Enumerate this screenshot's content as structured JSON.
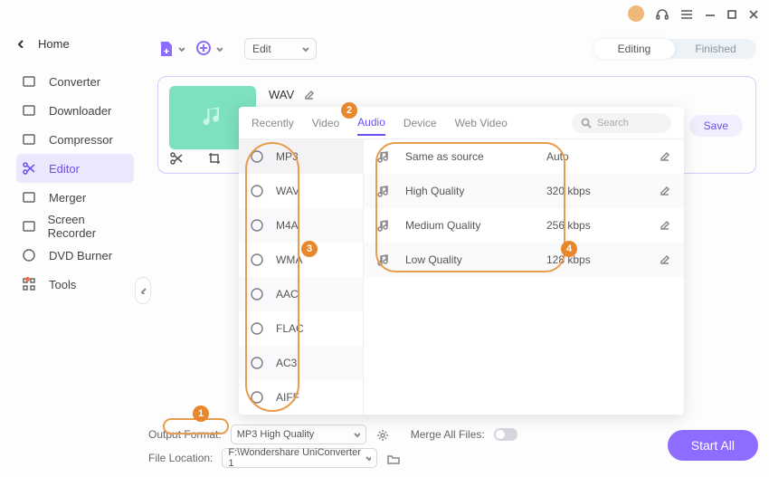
{
  "titlebar": {
    "icons": [
      "avatar",
      "headset",
      "menu",
      "min",
      "max",
      "close"
    ]
  },
  "sidebar": {
    "home": "Home",
    "items": [
      {
        "label": "Converter"
      },
      {
        "label": "Downloader"
      },
      {
        "label": "Compressor"
      },
      {
        "label": "Editor",
        "active": true
      },
      {
        "label": "Merger"
      },
      {
        "label": "Screen Recorder"
      },
      {
        "label": "DVD Burner"
      },
      {
        "label": "Tools",
        "dot": true
      }
    ]
  },
  "toolbar": {
    "edit_select": "Edit",
    "seg": [
      "Editing",
      "Finished"
    ],
    "seg_active": "Editing"
  },
  "card": {
    "filetype": "WAV",
    "save": "Save"
  },
  "popup": {
    "tabs": [
      "Recently",
      "Video",
      "Audio",
      "Device",
      "Web Video"
    ],
    "active_tab": "Audio",
    "search_placeholder": "Search",
    "formats": [
      "MP3",
      "WAV",
      "M4A",
      "WMA",
      "AAC",
      "FLAC",
      "AC3",
      "AIFF"
    ],
    "active_format": "MP3",
    "qualities": [
      {
        "label": "Same as source",
        "rate": "Auto"
      },
      {
        "label": "High Quality",
        "rate": "320 kbps"
      },
      {
        "label": "Medium Quality",
        "rate": "256 kbps"
      },
      {
        "label": "Low Quality",
        "rate": "128 kbps"
      }
    ]
  },
  "bottom": {
    "output_label": "Output Format:",
    "output_value": "MP3 High Quality",
    "merge_label": "Merge All Files:",
    "loc_label": "File Location:",
    "loc_value": "F:\\Wondershare UniConverter 1",
    "start": "Start All"
  },
  "callouts": {
    "1": "1",
    "2": "2",
    "3": "3",
    "4": "4"
  }
}
